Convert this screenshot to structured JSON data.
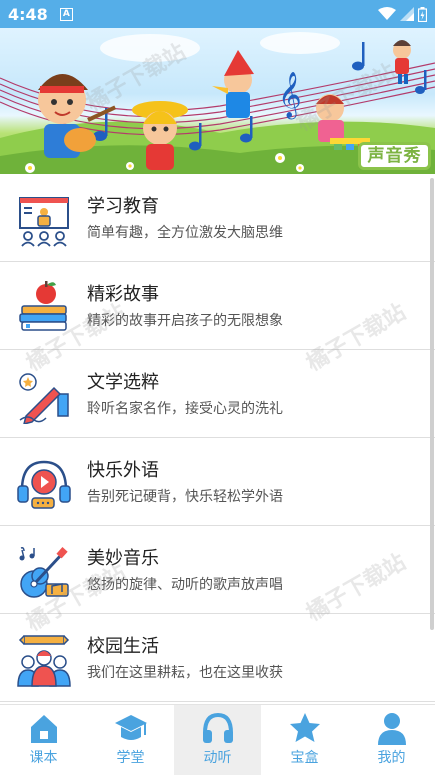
{
  "status_bar": {
    "time": "4:48",
    "notif_letter": "A"
  },
  "banner": {
    "badge_text": "声音秀"
  },
  "list_items": [
    {
      "title": "学习教育",
      "subtitle": "简单有趣，全方位激发大脑思维",
      "icon": "classroom-icon"
    },
    {
      "title": "精彩故事",
      "subtitle": "精彩的故事开启孩子的无限想象",
      "icon": "books-apple-icon"
    },
    {
      "title": "文学选粹",
      "subtitle": "聆听名家名作，接受心灵的洗礼",
      "icon": "pen-writing-icon"
    },
    {
      "title": "快乐外语",
      "subtitle": "告别死记硬背，快乐轻松学外语",
      "icon": "headphones-video-icon"
    },
    {
      "title": "美妙音乐",
      "subtitle": "悠扬的旋律、动听的歌声放声唱",
      "icon": "guitar-music-icon"
    },
    {
      "title": "校园生活",
      "subtitle": "我们在这里耕耘，也在这里收获",
      "icon": "students-group-icon"
    }
  ],
  "watermark_text": "橘子下载站",
  "bottom_nav": [
    {
      "label": "课本",
      "icon": "house-icon",
      "active": false
    },
    {
      "label": "学堂",
      "icon": "graduation-cap-icon",
      "active": false
    },
    {
      "label": "动听",
      "icon": "headphones-icon",
      "active": true
    },
    {
      "label": "宝盒",
      "icon": "star-icon",
      "active": false
    },
    {
      "label": "我的",
      "icon": "person-icon",
      "active": false
    }
  ],
  "colors": {
    "status_bar": "#55aee8",
    "accent": "#4aa3df",
    "badge_green": "#7cb342"
  }
}
